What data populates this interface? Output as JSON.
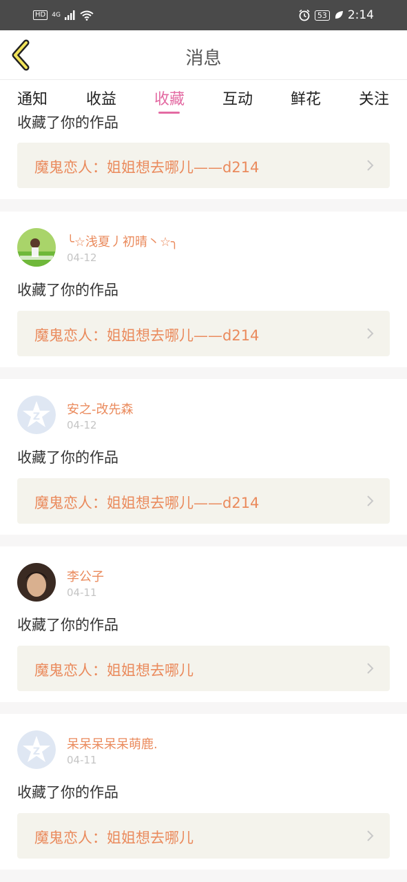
{
  "status_bar": {
    "network_hd": "HD",
    "network_type": "4G",
    "battery": "53",
    "time": "2:14"
  },
  "header": {
    "title": "消息"
  },
  "tabs": [
    {
      "label": "通知"
    },
    {
      "label": "收益"
    },
    {
      "label": "收藏"
    },
    {
      "label": "互动"
    },
    {
      "label": "鲜花"
    },
    {
      "label": "关注"
    }
  ],
  "active_tab": "收藏",
  "colors": {
    "accent_pink": "#e36aa2",
    "username_orange": "#ea8a5c",
    "work_box_bg": "#f4f3ec"
  },
  "items": [
    {
      "action": "收藏了你的作品",
      "work_title": "魔鬼恋人：姐姐想去哪儿——d214"
    },
    {
      "username": "╰☆浅夏丿初晴丶☆╮",
      "avatar": "photo-avatar-girl",
      "date": "04-12",
      "action": "收藏了你的作品",
      "work_title": "魔鬼恋人：姐姐想去哪儿——d214"
    },
    {
      "username": "安之-改先森",
      "avatar": "default-qq-avatar",
      "date": "04-12",
      "action": "收藏了你的作品",
      "work_title": "魔鬼恋人：姐姐想去哪儿——d214"
    },
    {
      "username": "李公子",
      "avatar": "photo-avatar-man",
      "date": "04-11",
      "action": "收藏了你的作品",
      "work_title": "魔鬼恋人：姐姐想去哪儿"
    },
    {
      "username": "呆呆呆呆呆萌鹿.",
      "avatar": "default-qq-avatar",
      "date": "04-11",
      "action": "收藏了你的作品",
      "work_title": "魔鬼恋人：姐姐想去哪儿"
    }
  ]
}
